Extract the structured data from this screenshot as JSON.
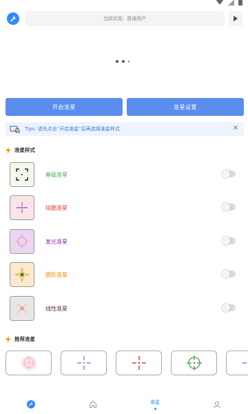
{
  "header": {
    "status_label": "当前状态:",
    "status_value": "普通用户"
  },
  "buttons": {
    "open": "开启准星",
    "settings": "准星设置"
  },
  "tips": {
    "text": "Tips: 请先点击“开启准星”后再选择准星样式",
    "close": "×"
  },
  "sections": {
    "styles_title": "准星样式",
    "recommend_title": "推荐准星"
  },
  "styles": [
    {
      "label": "基础准星",
      "color": "#4caf50",
      "thumb_bg": "#f1f8ec",
      "icon": "basic-crosshair-icon"
    },
    {
      "label": "炫酷准星",
      "color": "#e53935",
      "thumb_bg": "#fbe4e6",
      "icon": "cool-crosshair-icon"
    },
    {
      "label": "发光准星",
      "color": "#8e24aa",
      "thumb_bg": "#ead6f0",
      "icon": "glow-crosshair-icon"
    },
    {
      "label": "圆形准星",
      "color": "#ef8a00",
      "thumb_bg": "#fde9cf",
      "icon": "circle-crosshair-icon"
    },
    {
      "label": "线性准星",
      "color": "#4e342e",
      "thumb_bg": "#e8e6e6",
      "icon": "linear-crosshair-icon"
    }
  ],
  "toggles": [
    false,
    false,
    false,
    false,
    false
  ],
  "recommended": [
    "pink-circle-crosshair-icon",
    "blue-cross-crosshair-icon",
    "red-cross-crosshair-icon",
    "green-target-crosshair-icon",
    "purple-cross-crosshair-icon"
  ],
  "nav": {
    "active_label": "准星",
    "items": [
      "wrench-icon",
      "home-icon",
      "crosshair-tab",
      "user-icon"
    ]
  },
  "colors": {
    "accent": "#5b8def",
    "brand": "#2d8bff"
  }
}
